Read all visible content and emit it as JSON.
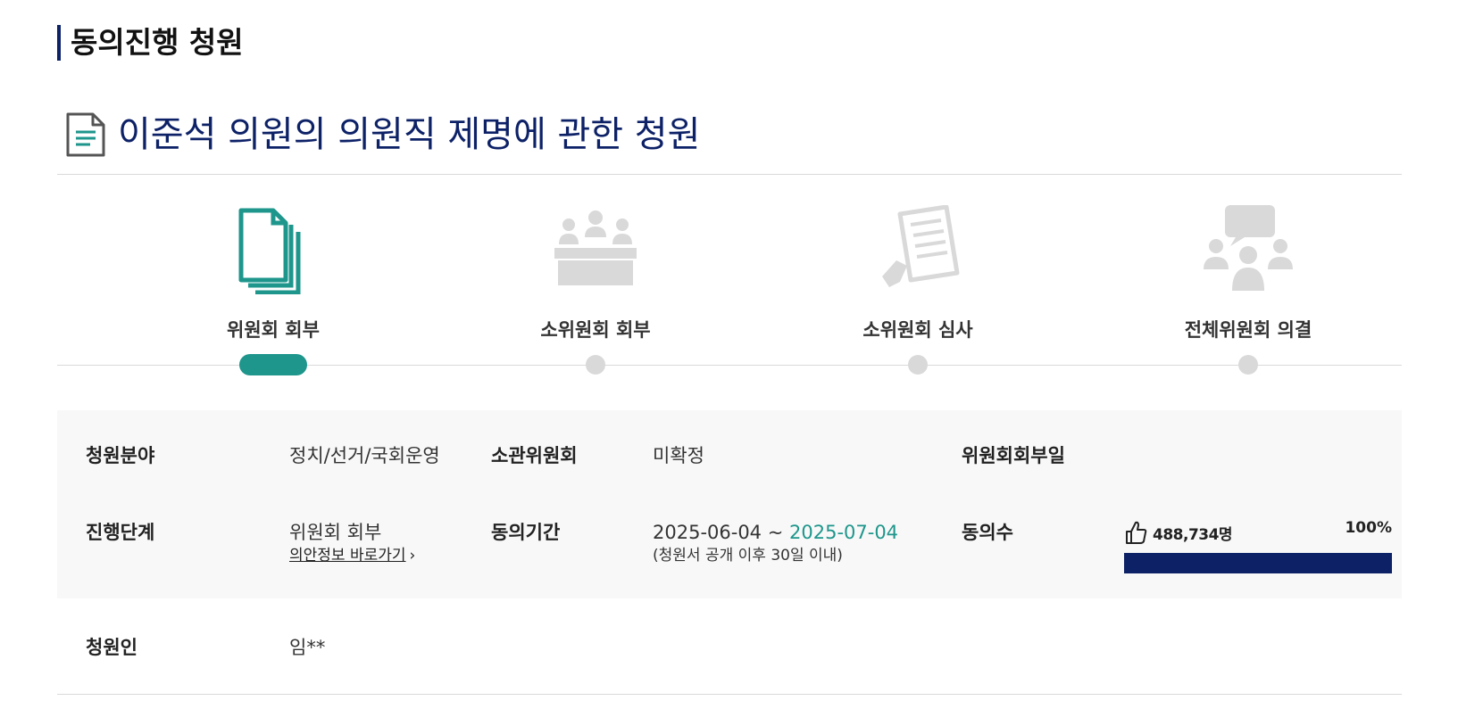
{
  "section_heading": "동의진행 청원",
  "petition": {
    "icon": "document-icon",
    "title": "이준석 의원의 의원직 제명에 관한 청원"
  },
  "colors": {
    "navy": "#0d2167",
    "teal": "#1e968c",
    "inactive_gray": "#d9d9d9"
  },
  "steps": [
    {
      "label": "위원회 회부",
      "icon": "documents-stack-icon",
      "active": true
    },
    {
      "label": "소위원회 회부",
      "icon": "meeting-table-icon",
      "active": false
    },
    {
      "label": "소위원회 심사",
      "icon": "document-review-icon",
      "active": false
    },
    {
      "label": "전체위원회 의결",
      "icon": "group-discussion-icon",
      "active": false
    }
  ],
  "info": {
    "field_label": "청원분야",
    "field_value": "정치/선거/국회운영",
    "committee_label": "소관위원회",
    "committee_value": "미확정",
    "referral_date_label": "위원회회부일",
    "referral_date_value": "",
    "stage_label": "진행단계",
    "stage_value": "위원회 회부",
    "bill_link": "의안정보 바로가기",
    "period_label": "동의기간",
    "period_start": "2025-06-04 ~ ",
    "period_end": "2025-07-04",
    "period_note": "(청원서 공개 이후 30일 이내)",
    "agree_label": "동의수",
    "agree_count": "488,734명",
    "agree_percent_text": "100%",
    "agree_progress": 1.0,
    "petitioner_label": "청원인",
    "petitioner_value": "임**"
  }
}
